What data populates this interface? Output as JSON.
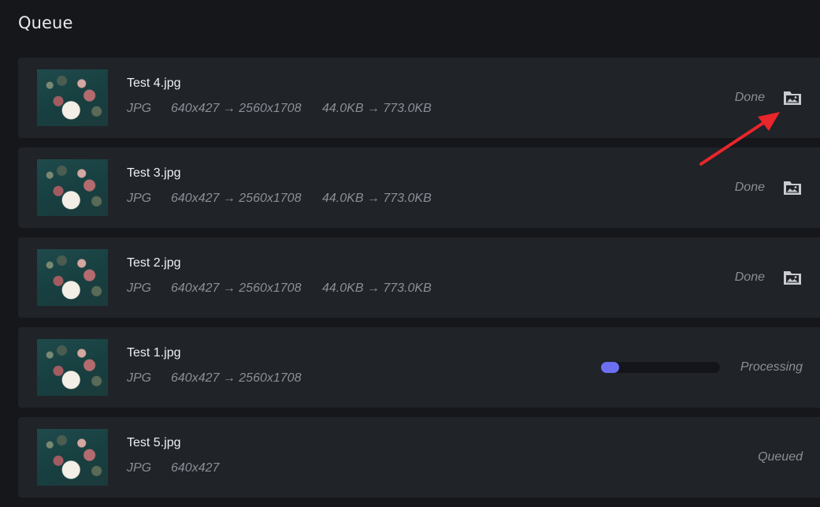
{
  "page": {
    "title": "Queue"
  },
  "items": [
    {
      "name": "Test 4.jpg",
      "format": "JPG",
      "dimensions": "640x427 → 2560x1708",
      "size": "44.0KB → 773.0KB",
      "status": "Done",
      "has_folder_button": true
    },
    {
      "name": "Test 3.jpg",
      "format": "JPG",
      "dimensions": "640x427 → 2560x1708",
      "size": "44.0KB → 773.0KB",
      "status": "Done",
      "has_folder_button": true
    },
    {
      "name": "Test 2.jpg",
      "format": "JPG",
      "dimensions": "640x427 → 2560x1708",
      "size": "44.0KB → 773.0KB",
      "status": "Done",
      "has_folder_button": true
    },
    {
      "name": "Test 1.jpg",
      "format": "JPG",
      "dimensions": "640x427 → 2560x1708",
      "size": "",
      "status": "Processing",
      "progress_fraction": 0.15,
      "has_folder_button": false
    },
    {
      "name": "Test 5.jpg",
      "format": "JPG",
      "dimensions": "640x427",
      "size": "",
      "status": "Queued",
      "has_folder_button": false
    }
  ],
  "icons": {
    "folder_button": "folder-image-icon",
    "annotation": "red-arrow-icon"
  },
  "colors": {
    "background": "#15171b",
    "card": "#202328",
    "progress_fill": "#6c6ff2",
    "progress_track": "#13151a",
    "annotation_arrow": "#e8262b"
  }
}
